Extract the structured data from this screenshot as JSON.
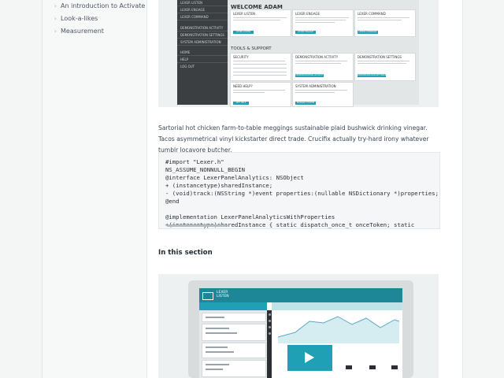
{
  "sidebar": {
    "items": [
      {
        "label": "An introduction to Activate"
      },
      {
        "label": "Look-a-likes"
      },
      {
        "label": "Measurement"
      }
    ]
  },
  "app_screenshot": {
    "nav": [
      "LEXER LISTEN",
      "LEXER ENGAGE",
      "LEXER COMMAND",
      "DEMONSTRATION ACTIVITY",
      "DEMONSTRATION SETTINGS",
      "SYSTEM ADMINISTRATION",
      "HOME",
      "HELP",
      "LOG OUT"
    ],
    "welcome": "WELCOME ADAM",
    "tools_heading": "TOOLS & SUPPORT",
    "cards_top": [
      {
        "title": "LEXER LISTEN",
        "button": "LEXER LISTEN"
      },
      {
        "title": "LEXER ENGAGE",
        "button": "LEXER ENGAGE"
      },
      {
        "title": "LEXER COMMAND",
        "button": "LEXER COMMAND"
      }
    ],
    "cards_mid": [
      {
        "title": "SECURITY",
        "button": "SECURITY"
      },
      {
        "title": "DEMONSTRATION ACTIVITY",
        "button": "DEMONSTRATION ACTIVITY"
      },
      {
        "title": "DEMONSTRATION SETTINGS",
        "button": "DEMONSTRATION SETTINGS"
      }
    ],
    "cards_bottom": [
      {
        "title": "NEED HELP?",
        "button": "GET HELP"
      },
      {
        "title": "SYSTEM ADMINISTRATION",
        "button": "MANAGE SYSTEM"
      }
    ]
  },
  "content": {
    "paragraph": "Sartorial hot chicken farm-to-table meggings sustainable plaid bushwick drinking vinegar. Tacos asymmetrical vinyl kickstarter direct trade. Crucifix actually try-hard irony whatever tumblr locavore butcher.",
    "code_lines": [
      "#import \"Lexer.h\"",
      "NS_ASSUME_NONNULL_BEGIN",
      "@interface LexerPanelAnalytics: NSObject",
      "+ (instancetype)sharedInstance;",
      "- (void)track:(NSString *)event properties:(nullable NSDictionary *)properties;",
      "@end",
      "",
      "@implementation LexerPanelAnalyticsWithProperties",
      "+(instancetype)sharedInstance { static dispatch_once_t onceToken; static"
    ],
    "section_heading": "In this section"
  },
  "video_preview": {
    "app_title": "LEXER LISTEN"
  },
  "colors": {
    "accent": "#1fa0b4",
    "nav_dark": "#3b3f42",
    "header_teal": "#1d8798"
  },
  "icons": [
    "chevron-right-icon",
    "play-icon",
    "lexer-logo-icon"
  ]
}
